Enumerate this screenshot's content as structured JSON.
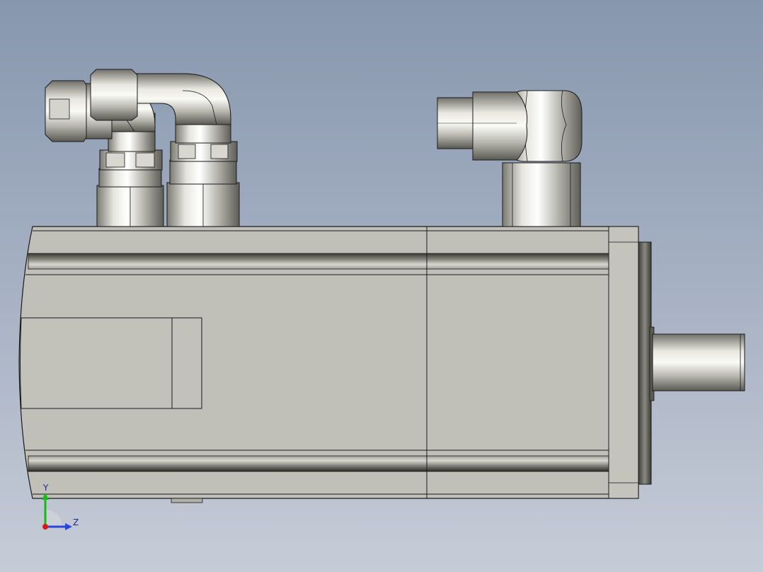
{
  "viewport": {
    "background_top": "#8797ae",
    "background_bottom": "#c6ccd7",
    "model_body_color": "#c0c0b8",
    "model_edge_color": "#202020",
    "metal_highlight": "#f4f4ee",
    "metal_shadow": "#6e6e66"
  },
  "triad": {
    "y_label": "Y",
    "z_label": "Z",
    "y_color": "#18b818",
    "z_color": "#2a46d8",
    "x_color": "#d81818"
  },
  "parts": [
    "motor-housing",
    "front-flange",
    "output-shaft",
    "power-connector-elbow",
    "encoder-connector-elbow",
    "brake-connector-elbow",
    "nameplate"
  ]
}
